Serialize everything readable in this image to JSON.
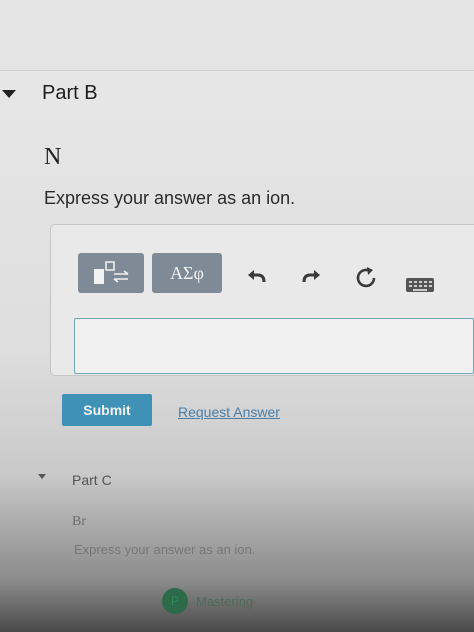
{
  "part_b": {
    "title": "Part B",
    "element": "N",
    "instruction": "Express your answer as an ion."
  },
  "toolbar": {
    "templates_icon": "templates-icon",
    "symbols_label": "ΑΣφ",
    "undo_icon": "undo-icon",
    "redo_icon": "redo-icon",
    "reset_icon": "reset-icon",
    "keyboard_icon": "keyboard-icon"
  },
  "answer": {
    "value": "",
    "placeholder": ""
  },
  "actions": {
    "submit_label": "Submit",
    "request_answer_label": "Request Answer"
  },
  "part_c": {
    "title": "Part C",
    "element": "Br",
    "instruction": "Express your answer as an ion."
  },
  "footer": {
    "text": "Mastering"
  },
  "colors": {
    "submit_bg": "#3f92b6",
    "toolbar_btn_bg": "#7e8b96",
    "link": "#4a7ea6",
    "input_border": "#6fa7b3"
  }
}
